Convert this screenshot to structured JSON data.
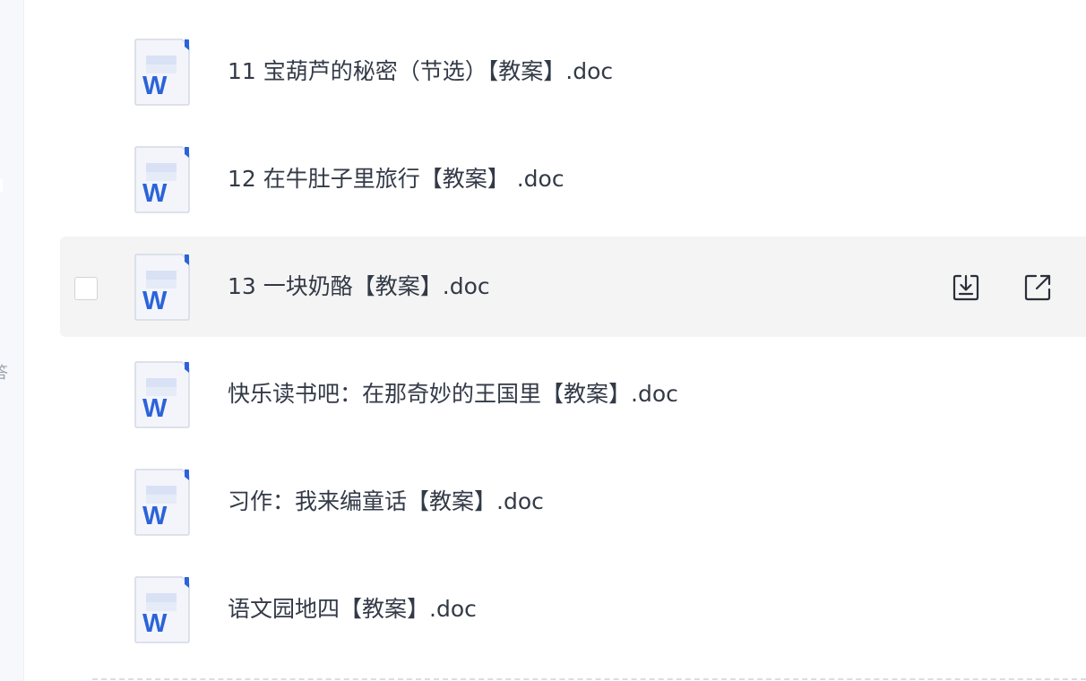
{
  "sidebar": {
    "partial_label": "答"
  },
  "files": [
    {
      "name": "11 宝葫芦的秘密（节选）【教案】.doc",
      "hovered": false
    },
    {
      "name": "12 在牛肚子里旅行【教案】 .doc",
      "hovered": false
    },
    {
      "name": "13 一块奶酪【教案】.doc",
      "hovered": true
    },
    {
      "name": "快乐读书吧：在那奇妙的王国里【教案】.doc",
      "hovered": false
    },
    {
      "name": "习作：我来编童话【教案】.doc",
      "hovered": false
    },
    {
      "name": "语文园地四【教案】.doc",
      "hovered": false
    }
  ],
  "icons": {
    "file_type": "word-doc-icon",
    "file_letter": "W",
    "download": "download-icon",
    "open": "open-external-icon"
  },
  "colors": {
    "word_blue": "#2b63d9",
    "hover_bg": "#f4f4f4",
    "text": "#333a47"
  }
}
